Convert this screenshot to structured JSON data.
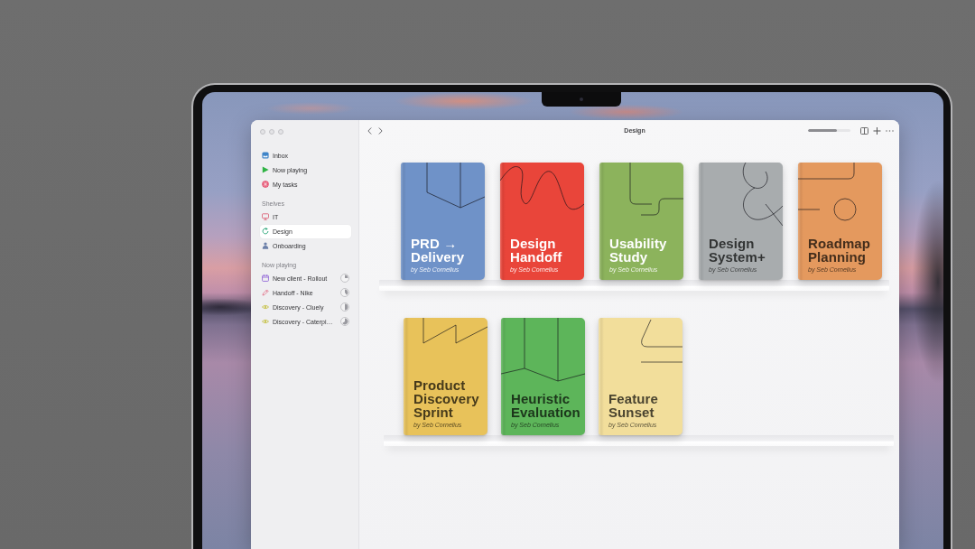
{
  "toolbar": {
    "title": "Design",
    "zoom_slider": {
      "level": 0.68
    }
  },
  "sidebar": {
    "items": [
      {
        "label": "Inbox",
        "selected": false
      },
      {
        "label": "Now playing",
        "selected": false
      },
      {
        "label": "My tasks",
        "selected": false
      }
    ],
    "sections": [
      {
        "heading": "Shelves",
        "items": [
          {
            "label": "IT",
            "selected": false
          },
          {
            "label": "Design",
            "selected": true
          },
          {
            "label": "Onboarding",
            "selected": false
          }
        ]
      },
      {
        "heading": "Now playing",
        "items": [
          {
            "label": "New client - Rollout",
            "selected": false
          },
          {
            "label": "Handoff - Nike",
            "selected": false
          },
          {
            "label": "Discovery - Cluely",
            "selected": false
          },
          {
            "label": "Discovery - Caterpi…",
            "selected": false
          }
        ]
      }
    ]
  },
  "shelves": [
    {
      "books": [
        {
          "title_lines": [
            "PRD →",
            "Delivery"
          ],
          "author": "by Seb Cornelius",
          "color": "#6f92c8",
          "dark_title": false
        },
        {
          "title_lines": [
            "Design",
            "Handoff"
          ],
          "author": "by Seb Cornelius",
          "color": "#e9453a",
          "dark_title": false
        },
        {
          "title_lines": [
            "Usability",
            "Study"
          ],
          "author": "by Seb Cornelius",
          "color": "#8cb35c",
          "dark_title": false
        },
        {
          "title_lines": [
            "Design",
            "System+"
          ],
          "author": "by Seb Cornelius",
          "color": "#a8acae",
          "dark_title": true
        },
        {
          "title_lines": [
            "Roadmap",
            "Planning"
          ],
          "author": "by Seb Cornelius",
          "color": "#e4995e",
          "dark_title": true
        }
      ]
    },
    {
      "books": [
        {
          "title_lines": [
            "Product",
            "Discovery",
            "Sprint"
          ],
          "author": "by Seb Cornelius",
          "color": "#e8c25a",
          "dark_title": true
        },
        {
          "title_lines": [
            "Heuristic",
            "Evaluation"
          ],
          "author": "by Seb Cornelius",
          "color": "#5db55a",
          "dark_title": true
        },
        {
          "title_lines": [
            "Feature",
            "Sunset"
          ],
          "author": "by Seb Cornelius",
          "color": "#f2de9b",
          "dark_title": true
        }
      ]
    }
  ]
}
